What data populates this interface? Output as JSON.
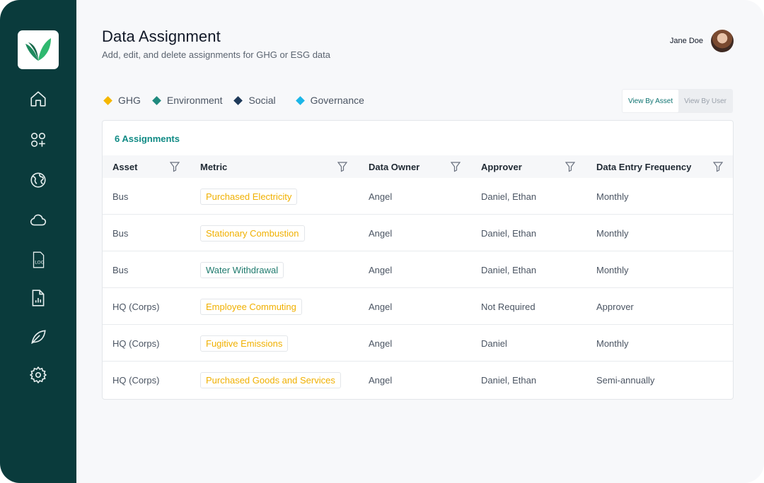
{
  "header": {
    "title": "Data Assignment",
    "subtitle": "Add, edit, and delete assignments for GHG or ESG data"
  },
  "user": {
    "name": "Jane Doe"
  },
  "sidebar": {
    "items": [
      {
        "icon": "home-icon"
      },
      {
        "icon": "apps-add-icon"
      },
      {
        "icon": "globe-icon"
      },
      {
        "icon": "cloud-icon"
      },
      {
        "icon": "log-file-icon"
      },
      {
        "icon": "report-file-icon"
      },
      {
        "icon": "leaf-icon"
      },
      {
        "icon": "gear-icon"
      }
    ]
  },
  "legend": [
    {
      "label": "GHG",
      "color": "#f5b700"
    },
    {
      "label": "Environment",
      "color": "#1f8a7e"
    },
    {
      "label": "Social",
      "color": "#1e3a5a"
    },
    {
      "label": "Governance",
      "color": "#1bb6e8"
    }
  ],
  "view_toggle": {
    "by_asset": "View By Asset",
    "by_user": "View By User",
    "selected": "View By Asset"
  },
  "table": {
    "count_label": "6 Assignments",
    "columns": [
      "Asset",
      "Metric",
      "Data Owner",
      "Approver",
      "Data Entry Frequency"
    ],
    "rows": [
      {
        "asset": "Bus",
        "metric": "Purchased Electricity",
        "metric_category": "GHG",
        "owner": "Angel",
        "approver": "Daniel, Ethan",
        "frequency": "Monthly"
      },
      {
        "asset": "Bus",
        "metric": "Stationary Combustion",
        "metric_category": "GHG",
        "owner": "Angel",
        "approver": "Daniel, Ethan",
        "frequency": "Monthly"
      },
      {
        "asset": "Bus",
        "metric": "Water Withdrawal",
        "metric_category": "Environment",
        "owner": "Angel",
        "approver": "Daniel, Ethan",
        "frequency": "Monthly"
      },
      {
        "asset": "HQ (Corps)",
        "metric": "Employee Commuting",
        "metric_category": "GHG",
        "owner": "Angel",
        "approver": "Not Required",
        "frequency": "Approver"
      },
      {
        "asset": "HQ (Corps)",
        "metric": "Fugitive Emissions",
        "metric_category": "GHG",
        "owner": "Angel",
        "approver": "Daniel",
        "frequency": "Monthly"
      },
      {
        "asset": "HQ (Corps)",
        "metric": "Purchased Goods and Services",
        "metric_category": "GHG",
        "owner": "Angel",
        "approver": "Daniel, Ethan",
        "frequency": "Semi-annually"
      }
    ]
  },
  "colors": {
    "sidebar": "#0a3b3c",
    "accent": "#0f8a84",
    "ghg_text": "#f0b000",
    "environment_text": "#1f7a6e"
  }
}
